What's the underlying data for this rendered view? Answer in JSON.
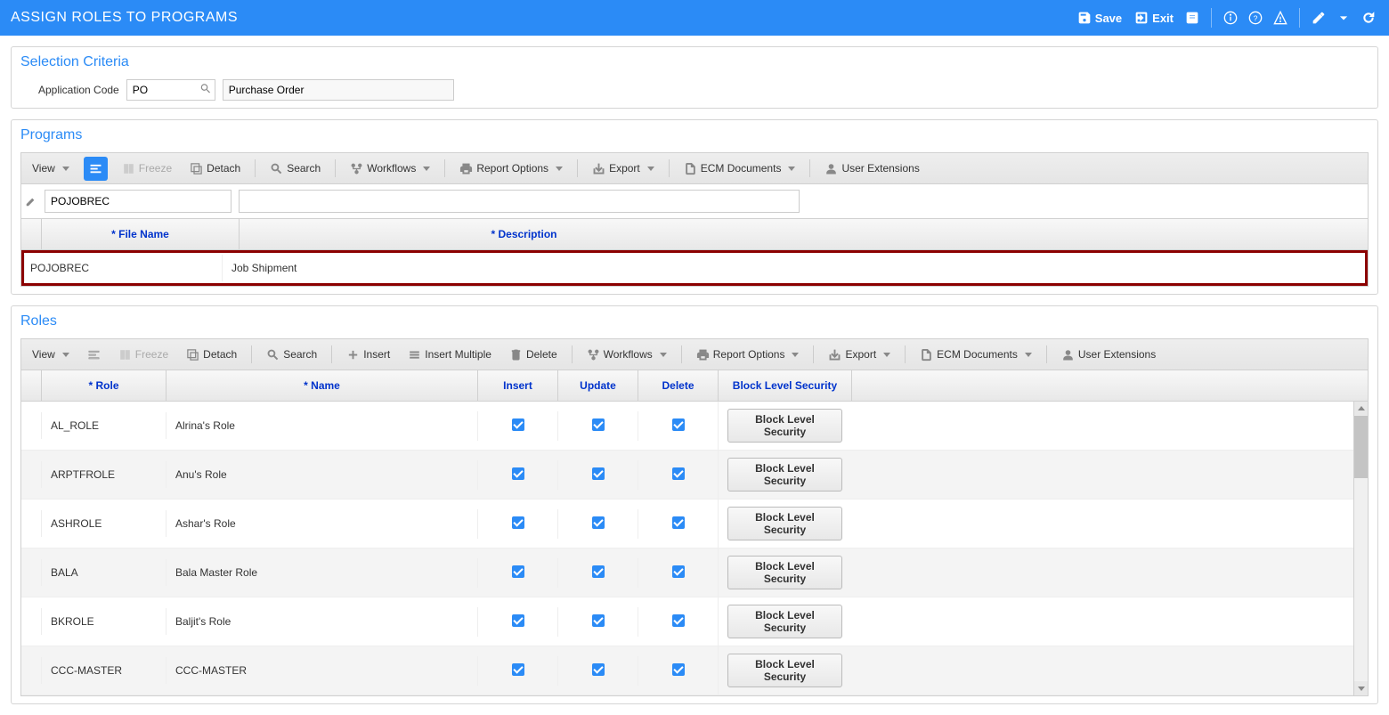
{
  "header": {
    "title": "ASSIGN ROLES TO PROGRAMS",
    "save_label": "Save",
    "exit_label": "Exit"
  },
  "selection": {
    "panel_title": "Selection Criteria",
    "app_code_label": "Application Code",
    "app_code_value": "PO",
    "app_code_desc": "Purchase Order"
  },
  "programs": {
    "panel_title": "Programs",
    "toolbar": {
      "view": "View",
      "freeze": "Freeze",
      "detach": "Detach",
      "search": "Search",
      "workflows": "Workflows",
      "report": "Report Options",
      "export": "Export",
      "ecm": "ECM Documents",
      "user_ext": "User Extensions"
    },
    "filter_filename": "POJOBREC",
    "filter_description": "",
    "columns": {
      "filename": "* File Name",
      "description": "* Description"
    },
    "rows": [
      {
        "filename": "POJOBREC",
        "description": "Job Shipment"
      }
    ]
  },
  "roles": {
    "panel_title": "Roles",
    "toolbar": {
      "view": "View",
      "freeze": "Freeze",
      "detach": "Detach",
      "search": "Search",
      "insert": "Insert",
      "insert_multi": "Insert Multiple",
      "delete": "Delete",
      "workflows": "Workflows",
      "report": "Report Options",
      "export": "Export",
      "ecm": "ECM Documents",
      "user_ext": "User Extensions"
    },
    "columns": {
      "role": "* Role",
      "name": "* Name",
      "insert": "Insert",
      "update": "Update",
      "delete": "Delete",
      "block_security": "Block Level Security"
    },
    "block_btn_label": "Block Level Security",
    "rows": [
      {
        "role": "AL_ROLE",
        "name": "Alrina's Role",
        "insert": true,
        "update": true,
        "delete": true
      },
      {
        "role": "ARPTFROLE",
        "name": "Anu's Role",
        "insert": true,
        "update": true,
        "delete": true
      },
      {
        "role": "ASHROLE",
        "name": "Ashar's Role",
        "insert": true,
        "update": true,
        "delete": true
      },
      {
        "role": "BALA",
        "name": "Bala Master Role",
        "insert": true,
        "update": true,
        "delete": true
      },
      {
        "role": "BKROLE",
        "name": "Baljit's Role",
        "insert": true,
        "update": true,
        "delete": true
      },
      {
        "role": "CCC-MASTER",
        "name": "CCC-MASTER",
        "insert": true,
        "update": true,
        "delete": true
      }
    ]
  }
}
